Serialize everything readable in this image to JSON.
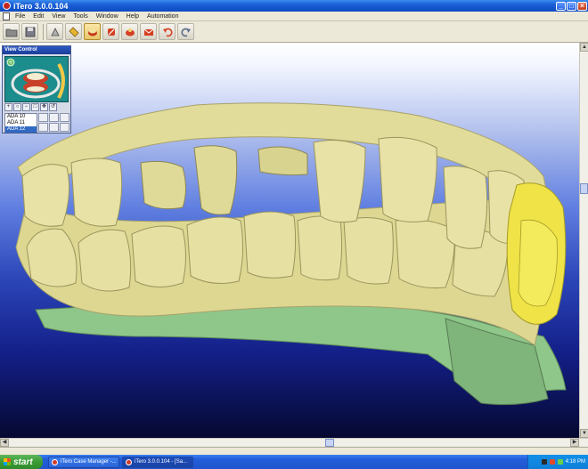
{
  "window": {
    "title": "iTero 3.0.0.104",
    "minimize_glyph": "_",
    "maximize_glyph": "□",
    "close_glyph": "×"
  },
  "menu": {
    "items": [
      "File",
      "Edit",
      "View",
      "Tools",
      "Window",
      "Help",
      "Automation"
    ]
  },
  "toolbar": {
    "buttons": [
      {
        "icon": "open-folder-icon"
      },
      {
        "icon": "save-icon"
      },
      {
        "icon": "scan-icon"
      },
      {
        "icon": "tag-icon"
      },
      {
        "icon": "model-icon",
        "active": true
      },
      {
        "icon": "prep-icon"
      },
      {
        "icon": "trim-icon"
      },
      {
        "icon": "send-icon"
      },
      {
        "icon": "undo-icon"
      },
      {
        "icon": "redo-icon"
      }
    ]
  },
  "view_control": {
    "title": "View Control",
    "teeth_list": [
      "ADA 10",
      "ADA 11",
      "ADA 12"
    ],
    "selected_index": 2
  },
  "taskbar": {
    "start_label": "start",
    "items": [
      {
        "label": "iTero Case Manager -...",
        "active": false
      },
      {
        "label": "iTero 3.0.0.104 - [Sa...",
        "active": true
      }
    ],
    "clock": "4:18 PM"
  },
  "colors": {
    "model_yellow": "#e2dc9a",
    "gingiva_green": "#8fcf8a",
    "highlight_yellow": "#efe348"
  }
}
